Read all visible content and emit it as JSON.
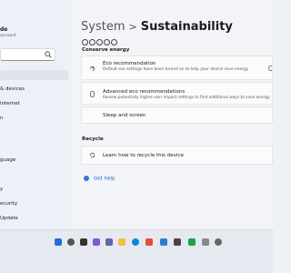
{
  "sidebar": {
    "user_name": "de",
    "user_account": "account",
    "search_icon": "search-icon",
    "items": [
      {
        "label": "",
        "active": true
      },
      {
        "label": "& devices",
        "active": false
      },
      {
        "label": "internet",
        "active": false
      },
      {
        "label": "n",
        "active": false
      },
      {
        "label": "guage",
        "active": false
      },
      {
        "label": "y",
        "active": false
      },
      {
        "label": "ecurity",
        "active": false
      },
      {
        "label": "Update",
        "active": false
      }
    ]
  },
  "header": {
    "parent": "System",
    "separator": ">",
    "current": "Sustainability"
  },
  "conserve": {
    "title": "Conserve energy",
    "eco_recommendation": {
      "title": "Eco recommendation",
      "desc": "Default eco settings have been turned on to help your device save energy",
      "icon": "energy-icon"
    },
    "advanced_eco": {
      "title": "Advanced eco recommendations",
      "desc": "Review potentially higher-user impact settings to find additional ways to save energy",
      "icon": "device-icon"
    },
    "sleep_and_screen": {
      "title": "Sleep and screen"
    }
  },
  "recycle": {
    "title": "Recycle",
    "learn": {
      "title": "Learn how to recycle this device",
      "icon": "recycle-icon"
    }
  },
  "help": {
    "label": "Get help",
    "icon": "help-icon"
  },
  "colors": {
    "accent": "#0a5cc4"
  }
}
